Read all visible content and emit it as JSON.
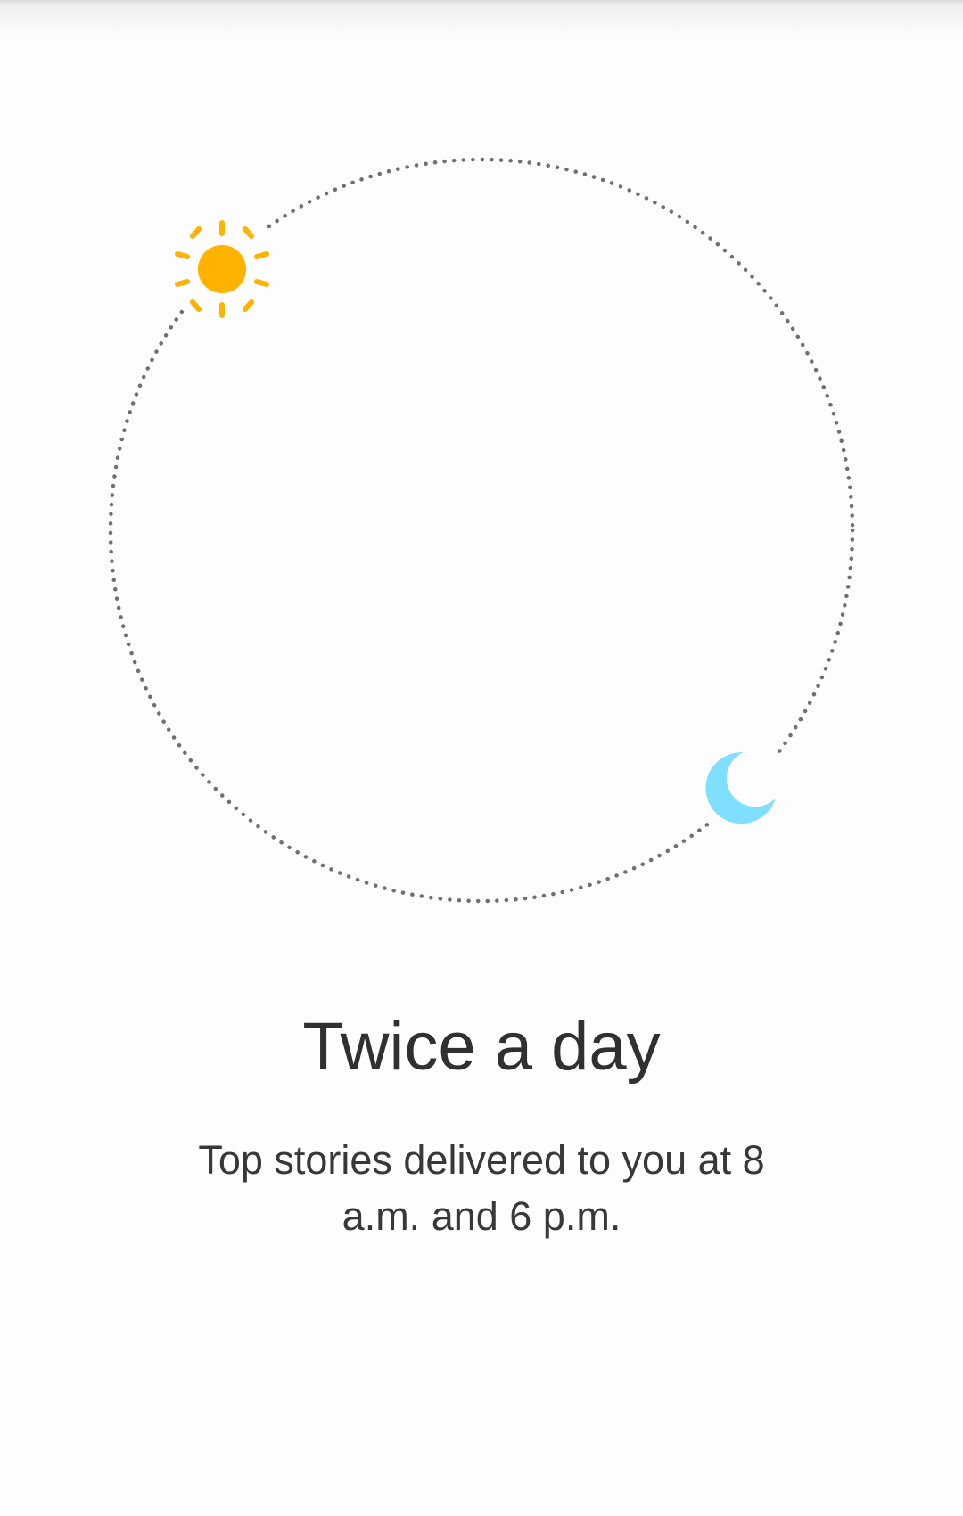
{
  "onboarding": {
    "title": "Twice a day",
    "subtitle": "Top stories delivered to you at 8 a.m. and 6 p.m."
  },
  "icons": {
    "morning": "sun-icon",
    "evening": "moon-icon"
  },
  "colors": {
    "sun": "#FFB300",
    "moon": "#80DEFF",
    "orbit": "#707070",
    "text": "#303030",
    "background": "#FDFDFD"
  }
}
